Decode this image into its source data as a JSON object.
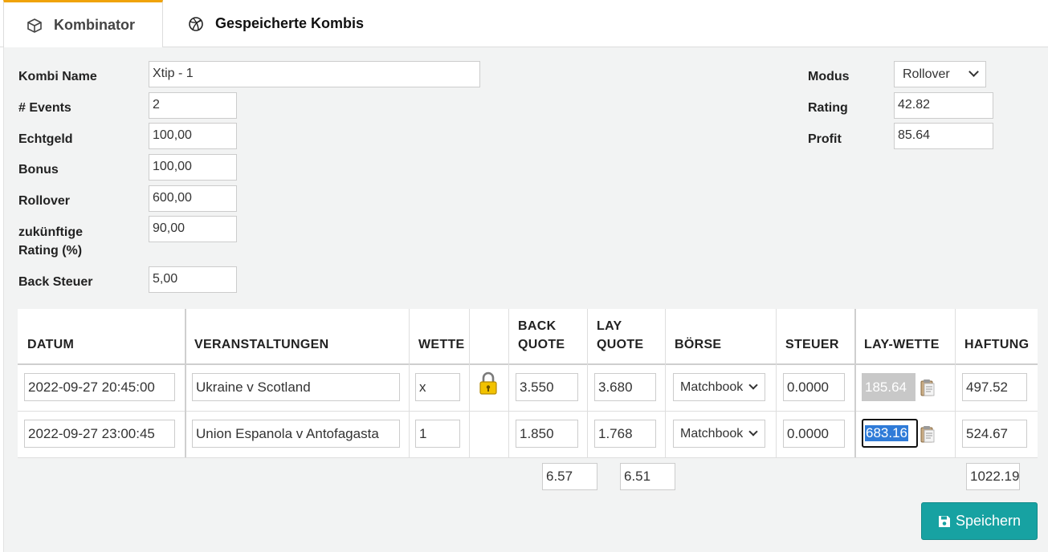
{
  "tabs": [
    {
      "label": "Kombinator",
      "active": true,
      "icon": "cube-icon"
    },
    {
      "label": "Gespeicherte Kombis",
      "active": false,
      "icon": "dribbble-ball-icon"
    }
  ],
  "form": {
    "kombi_name": {
      "label": "Kombi Name",
      "value": "Xtip - 1"
    },
    "events": {
      "label": "# Events",
      "value": "2"
    },
    "echtgeld": {
      "label": "Echtgeld",
      "value": "100,00"
    },
    "bonus": {
      "label": "Bonus",
      "value": "100,00"
    },
    "rollover": {
      "label": "Rollover",
      "value": "600,00"
    },
    "zukuenftige_rating": {
      "label_line1": "zukünftige",
      "label_line2": "Rating (%)",
      "value": "90,00"
    },
    "back_steuer": {
      "label": "Back Steuer",
      "value": "5,00"
    },
    "modus": {
      "label": "Modus",
      "value": "Rollover"
    },
    "rating": {
      "label": "Rating",
      "value": "42.82"
    },
    "profit": {
      "label": "Profit",
      "value": "85.64"
    }
  },
  "table": {
    "headers": {
      "datum": "DATUM",
      "veranstaltungen": "VERANSTALTUNGEN",
      "wette": "WETTE",
      "back_quote_1": "BACK",
      "back_quote_2": "QUOTE",
      "lay_quote_1": "LAY",
      "lay_quote_2": "QUOTE",
      "boerse": "BÖRSE",
      "steuer": "STEUER",
      "lay_wette": "LAY-WETTE",
      "haftung": "HAFTUNG"
    },
    "rows": [
      {
        "datum": "2022-09-27 20:45:00",
        "veranstaltung": "Ukraine v Scotland",
        "wette": "x",
        "locked": true,
        "back_quote": "3.550",
        "lay_quote": "3.680",
        "boerse": "Matchbook",
        "steuer": "0.0000",
        "lay_wette": "185.64",
        "haftung": "497.52"
      },
      {
        "datum": "2022-09-27 23:00:45",
        "veranstaltung": "Union Espanola v Antofagasta",
        "wette": "1",
        "locked": false,
        "back_quote": "1.850",
        "lay_quote": "1.768",
        "boerse": "Matchbook",
        "steuer": "0.0000",
        "lay_wette": "683.16",
        "haftung": "524.67"
      }
    ],
    "totals": {
      "back_quote": "6.57",
      "lay_quote": "6.51",
      "haftung": "1022.19"
    }
  },
  "save_button": {
    "label": "Speichern"
  },
  "colors": {
    "accent_tab": "#f0a30a",
    "save_button": "#17a2a2",
    "lock": "#f2c200",
    "selection": "#2f7bd8"
  }
}
